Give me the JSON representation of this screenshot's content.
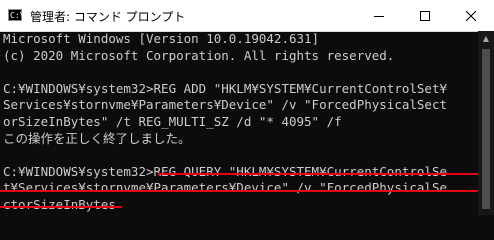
{
  "window": {
    "title": "管理者: コマンド プロンプト",
    "icon_text": "C:\\"
  },
  "controls": [
    {
      "name": "minimize-button",
      "icon": "minimize-icon"
    },
    {
      "name": "maximize-button",
      "icon": "maximize-icon"
    },
    {
      "name": "close-button",
      "icon": "close-icon"
    }
  ],
  "console_lines": [
    "Microsoft Windows [Version 10.0.19042.631]",
    "(c) 2020 Microsoft Corporation. All rights reserved.",
    "",
    "C:¥WINDOWS¥system32>REG ADD \"HKLM¥SYSTEM¥CurrentControlSet¥",
    "Services¥stornvme¥Parameters¥Device\" /v \"ForcedPhysicalSect",
    "orSizeInBytes\" /t REG_MULTI_SZ /d \"* 4095\" /f",
    "この操作を正しく終了しました。",
    "",
    "C:¥WINDOWS¥system32>REG QUERY \"HKLM¥SYSTEM¥CurrentControlSe",
    "t¥Services¥stornvme¥Parameters¥Device\" /v \"ForcedPhysicalSe",
    "ctorSizeInBytes"
  ],
  "highlight_color": "#e60012"
}
